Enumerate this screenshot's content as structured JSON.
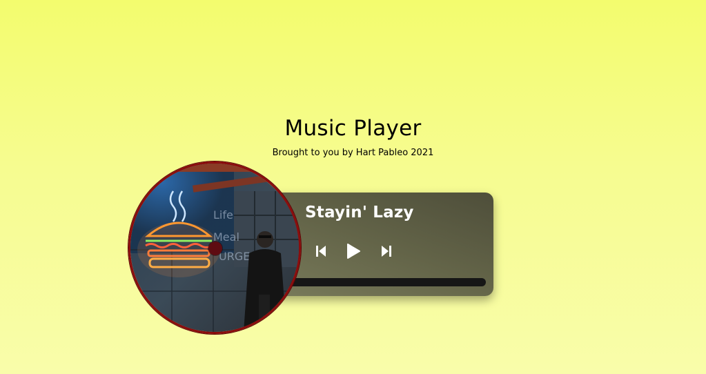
{
  "header": {
    "title": "Music Player",
    "subtitle": "Brought to you by Hart Pableo 2021"
  },
  "player": {
    "song_title": "Stayin' Lazy",
    "controls": {
      "previous_icon": "skip-back-icon",
      "play_icon": "play-icon",
      "next_icon": "skip-forward-icon"
    },
    "progress": 0.01,
    "album_art": {
      "description_icon": "album-art-disc"
    }
  },
  "colors": {
    "background_top": "#f3fc6e",
    "background_bottom": "#f9fdaa",
    "panel": "#636448",
    "disc_border": "#8b0d0d",
    "progress_track": "#161616",
    "progress_fill": "#ffffff"
  }
}
